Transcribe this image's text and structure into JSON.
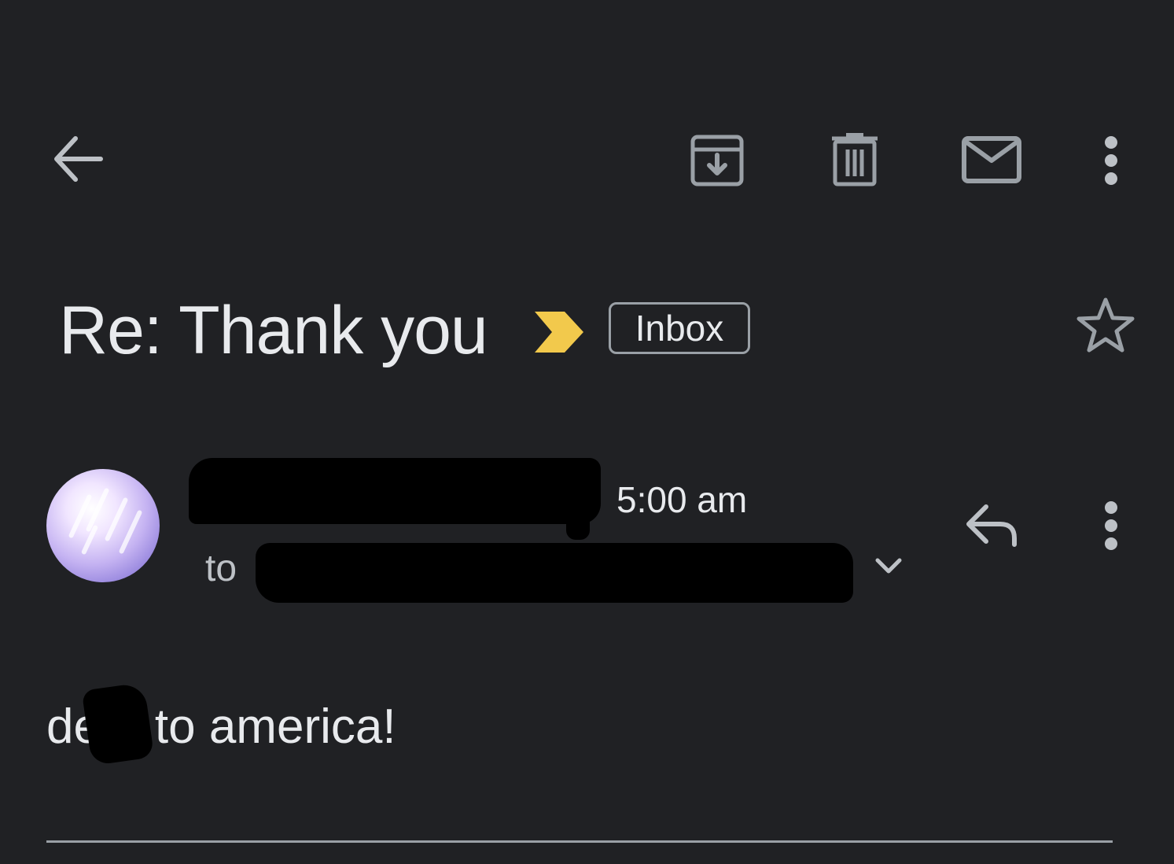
{
  "toolbar": {
    "back_icon": "arrow-back-icon",
    "archive_icon": "archive-icon",
    "delete_icon": "delete-icon",
    "mark_unread_icon": "mail-icon",
    "more_icon": "more-vert-icon"
  },
  "message": {
    "subject": "Re: Thank you",
    "importance_marker_color": "#f2c94c",
    "label": "Inbox",
    "star_icon": "star-outline-icon"
  },
  "sender": {
    "avatar_icon": "avatar",
    "time": "5:00 am",
    "to_label": "to",
    "expand_icon": "chevron-down-icon",
    "reply_icon": "reply-icon",
    "more_icon": "more-vert-icon"
  },
  "body": {
    "text": "de h to america!"
  },
  "colors": {
    "background": "#202124",
    "text_primary": "#e8eaed",
    "text_secondary": "#bdc1c6",
    "icon": "#9aa0a6",
    "importance": "#f2c94c"
  }
}
